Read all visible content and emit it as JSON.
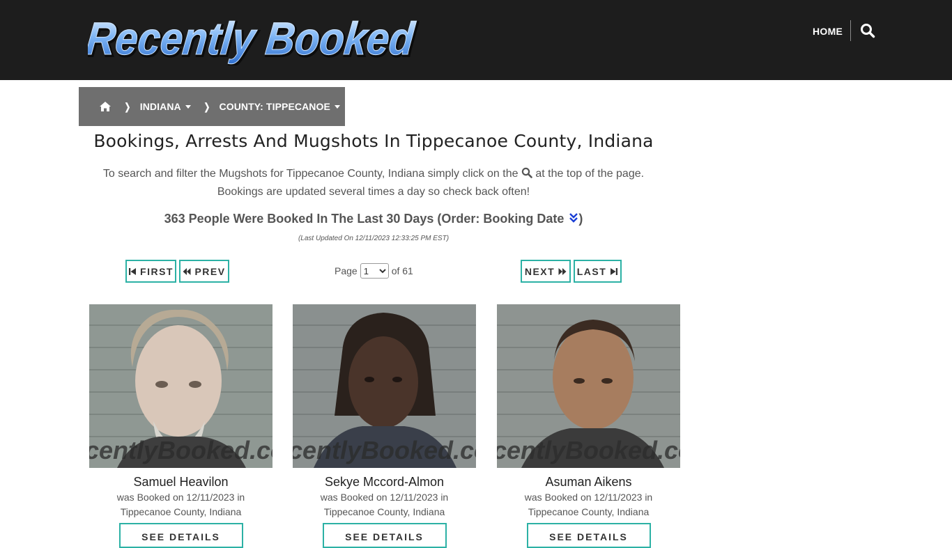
{
  "header": {
    "logo_text": "Recently Booked",
    "nav_home": "HOME",
    "search_icon": "search-icon"
  },
  "breadcrumb": {
    "home_icon": "home-icon",
    "state": "INDIANA",
    "county": "COUNTY: TIPPECANOE"
  },
  "main": {
    "title": "Bookings, Arrests And Mugshots In Tippecanoe County, Indiana",
    "intro_part1": "To search and filter the Mugshots for Tippecanoe County, Indiana simply click on the",
    "intro_part2": "at the top of the page.",
    "intro_line2": "Bookings are updated several times a day so check back often!",
    "count_text": "363 People Were Booked In The Last 30 Days (Order: Booking Date",
    "count_close": ")",
    "updated": "(Last Updated On 12/11/2023 12:33:25 PM EST)"
  },
  "pagination": {
    "first": "FIRST",
    "prev": "PREV",
    "next": "NEXT",
    "last": "LAST",
    "page_label": "Page",
    "current_page": "1",
    "of_label": "of 61"
  },
  "bookings": [
    {
      "name": "Samuel Heavilon",
      "line1": "was Booked on 12/11/2023 in",
      "line2": "Tippecanoe County, Indiana",
      "button": "SEE DETAILS",
      "watermark": "RecentlyBooked.com"
    },
    {
      "name": "Sekye Mccord-Almon",
      "line1": "was Booked on 12/11/2023 in",
      "line2": "Tippecanoe County, Indiana",
      "button": "SEE DETAILS",
      "watermark": "RecentlyBooked.com"
    },
    {
      "name": "Asuman Aikens",
      "line1": "was Booked on 12/11/2023 in",
      "line2": "Tippecanoe County, Indiana",
      "button": "SEE DETAILS",
      "watermark": "RecentlyBooked.com"
    }
  ],
  "colors": {
    "header_bg": "#1d1d1d",
    "breadcrumb_bg": "#6f6f6f",
    "accent": "#2cb1a5",
    "logo_blue": "#3a86e8"
  }
}
